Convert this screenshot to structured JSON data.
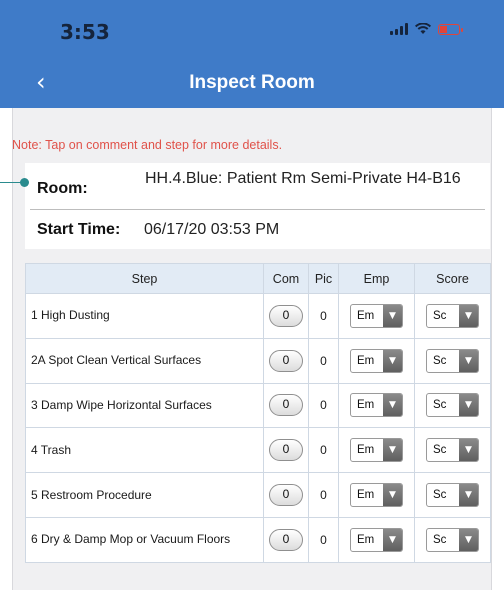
{
  "status": {
    "time": "3:53",
    "signal_icon": "signal-icon",
    "wifi_icon": "wifi-icon",
    "battery_icon": "battery-icon",
    "battery_color": "#e0453a"
  },
  "nav": {
    "back_icon": "‹",
    "title": "Inspect Room",
    "bar_color": "#3f7bc8"
  },
  "note": "Note: Tap on comment and step for more details.",
  "room": {
    "label": "Room:",
    "value": "HH.4.Blue: Patient Rm Semi-Private H4-B16"
  },
  "start_time": {
    "label": "Start Time:",
    "value": "06/17/20 03:53 PM"
  },
  "table": {
    "headers": {
      "step": "Step",
      "com": "Com",
      "pic": "Pic",
      "emp": "Emp",
      "score": "Score"
    },
    "rows": [
      {
        "step": "1 High Dusting",
        "com": "0",
        "pic": "0",
        "emp": "Em",
        "score": "Sc"
      },
      {
        "step": "2A Spot Clean Vertical Surfaces",
        "com": "0",
        "pic": "0",
        "emp": "Em",
        "score": "Sc"
      },
      {
        "step": "3 Damp Wipe Horizontal Surfaces",
        "com": "0",
        "pic": "0",
        "emp": "Em",
        "score": "Sc"
      },
      {
        "step": "4 Trash",
        "com": "0",
        "pic": "0",
        "emp": "Em",
        "score": "Sc"
      },
      {
        "step": "5 Restroom Procedure",
        "com": "0",
        "pic": "0",
        "emp": "Em",
        "score": "Sc"
      },
      {
        "step": "6 Dry & Damp Mop or Vacuum Floors",
        "com": "0",
        "pic": "0",
        "emp": "Em",
        "score": "Sc"
      }
    ]
  },
  "dropdown_arrow": "▼"
}
